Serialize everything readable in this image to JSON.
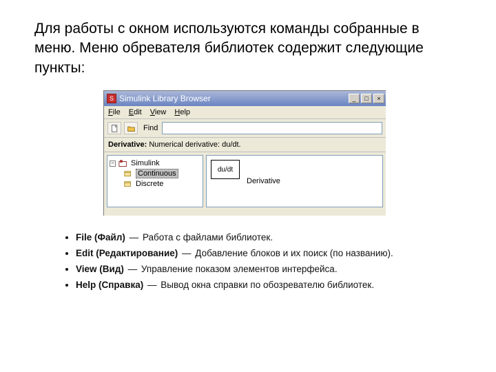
{
  "intro_text": "Для работы с окном используются команды собранные в меню. Меню обревателя библиотек содержит следующие пункты:",
  "window": {
    "title": "Simulink Library Browser",
    "menu": {
      "file": "File",
      "edit": "Edit",
      "view": "View",
      "help": "Help"
    },
    "toolbar": {
      "find_label": "Find",
      "find_value": ""
    },
    "info": {
      "label": "Derivative:",
      "desc": "Numerical derivative:  du/dt."
    },
    "tree": {
      "root": "Simulink",
      "item_continuous": "Continuous",
      "item_discrete": "Discrete"
    },
    "block": {
      "icon_text": "du/dt",
      "label": "Derivative"
    }
  },
  "bullets": [
    {
      "title": "File (Файл)",
      "dash": "—",
      "desc": "Работа с файлами библиотек."
    },
    {
      "title": "Edit (Редактирование)",
      "dash": "—",
      "desc": "Добавление блоков и их поиск (по названию)."
    },
    {
      "title": "View (Вид)",
      "dash": "—",
      "desc": "Управление показом элементов интерфейса."
    },
    {
      "title": "Help (Справка)",
      "dash": "—",
      "desc": "Вывод окна справки по обозревателю библиотек."
    }
  ]
}
